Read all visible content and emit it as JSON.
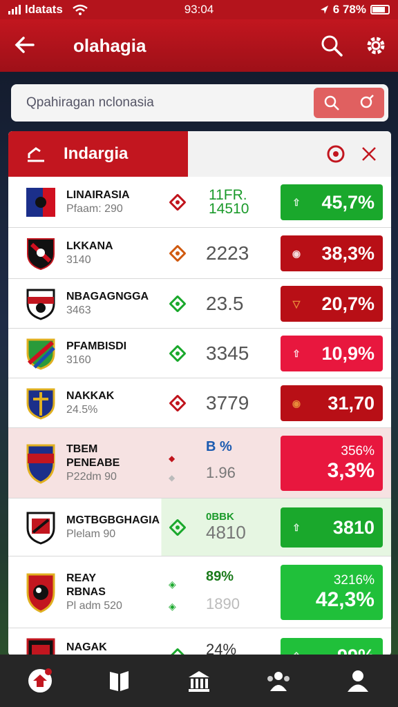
{
  "status_bar": {
    "carrier": "ldatats",
    "time": "93:04",
    "battery": "6 78%"
  },
  "header": {
    "title": "olahagia"
  },
  "search": {
    "placeholder": "Qpahiragan nclonasia"
  },
  "panel": {
    "tab_label": "Indargia"
  },
  "rows": [
    {
      "name": "LINAIRASIA",
      "sub": "Pfaam: 290",
      "value": "11FR. 14510",
      "value_color": "#1a9a2a",
      "diamond_color": "#c0141c",
      "pct": "45,7%",
      "pct_sub": "",
      "pct_color": "green",
      "arrow": "up"
    },
    {
      "name": "LKKANA",
      "sub": "3140",
      "value": "2223",
      "value_color": "#555",
      "diamond_color": "#d05a10",
      "pct": "38,3%",
      "pct_sub": "",
      "pct_color": "red",
      "arrow": "circle"
    },
    {
      "name": "NBAGAGNGGA",
      "sub": "3463",
      "value": "23.5",
      "value_color": "#555",
      "diamond_color": "#1aa82c",
      "pct": "20,7%",
      "pct_sub": "",
      "pct_color": "red",
      "arrow": "down"
    },
    {
      "name": "PFAMBISDI",
      "sub": "3160",
      "value": "3345",
      "value_color": "#555",
      "diamond_color": "#1aa82c",
      "pct": "10,9%",
      "pct_sub": "",
      "pct_color": "pink",
      "arrow": "up"
    },
    {
      "name": "NAKKAK",
      "sub": "24.5%",
      "value": "3779",
      "value_color": "#555",
      "diamond_color": "#c0141c",
      "pct": "31,70",
      "pct_sub": "",
      "pct_color": "red",
      "arrow": "circle"
    },
    {
      "name": "TBEM PENEABE",
      "sub": "P22dm 90",
      "value": "B %",
      "value2": "1.96",
      "value_color": "#1a5ab0",
      "diamond_color": "#c0141c",
      "pct": "3,3%",
      "pct_sub": "356%",
      "pct_color": "pink",
      "arrow": ""
    },
    {
      "name": "MGTBGBGHAGIA",
      "sub": "Plelam 90",
      "value": "0BBK",
      "value2": "4810",
      "value_color": "#1a9a2a",
      "diamond_color": "#1aa82c",
      "pct": "3810",
      "pct_sub": "",
      "pct_color": "green",
      "arrow": "up"
    },
    {
      "name": "REAY RBNAS",
      "sub": "Pl adm 520",
      "value": "89%",
      "value2": "1890",
      "value_color": "#1a7a1a",
      "diamond_color": "#1aa82c",
      "pct": "42,3%",
      "pct_sub": "3216%",
      "pct_color": "lgreen",
      "arrow": ""
    },
    {
      "name": "NAGAK",
      "sub": "",
      "value": "24%",
      "value_color": "#333",
      "diamond_color": "#1aa82c",
      "pct": "99%",
      "pct_sub": "",
      "pct_color": "lgreen",
      "arrow": "up"
    }
  ],
  "colors": {
    "brand_red": "#c2161f",
    "up_green": "#1aa82c",
    "down_red": "#b80f16",
    "alert_pink": "#e8173e"
  },
  "bottom_nav": [
    "home-icon",
    "book-icon",
    "bank-icon",
    "community-icon",
    "profile-icon"
  ]
}
